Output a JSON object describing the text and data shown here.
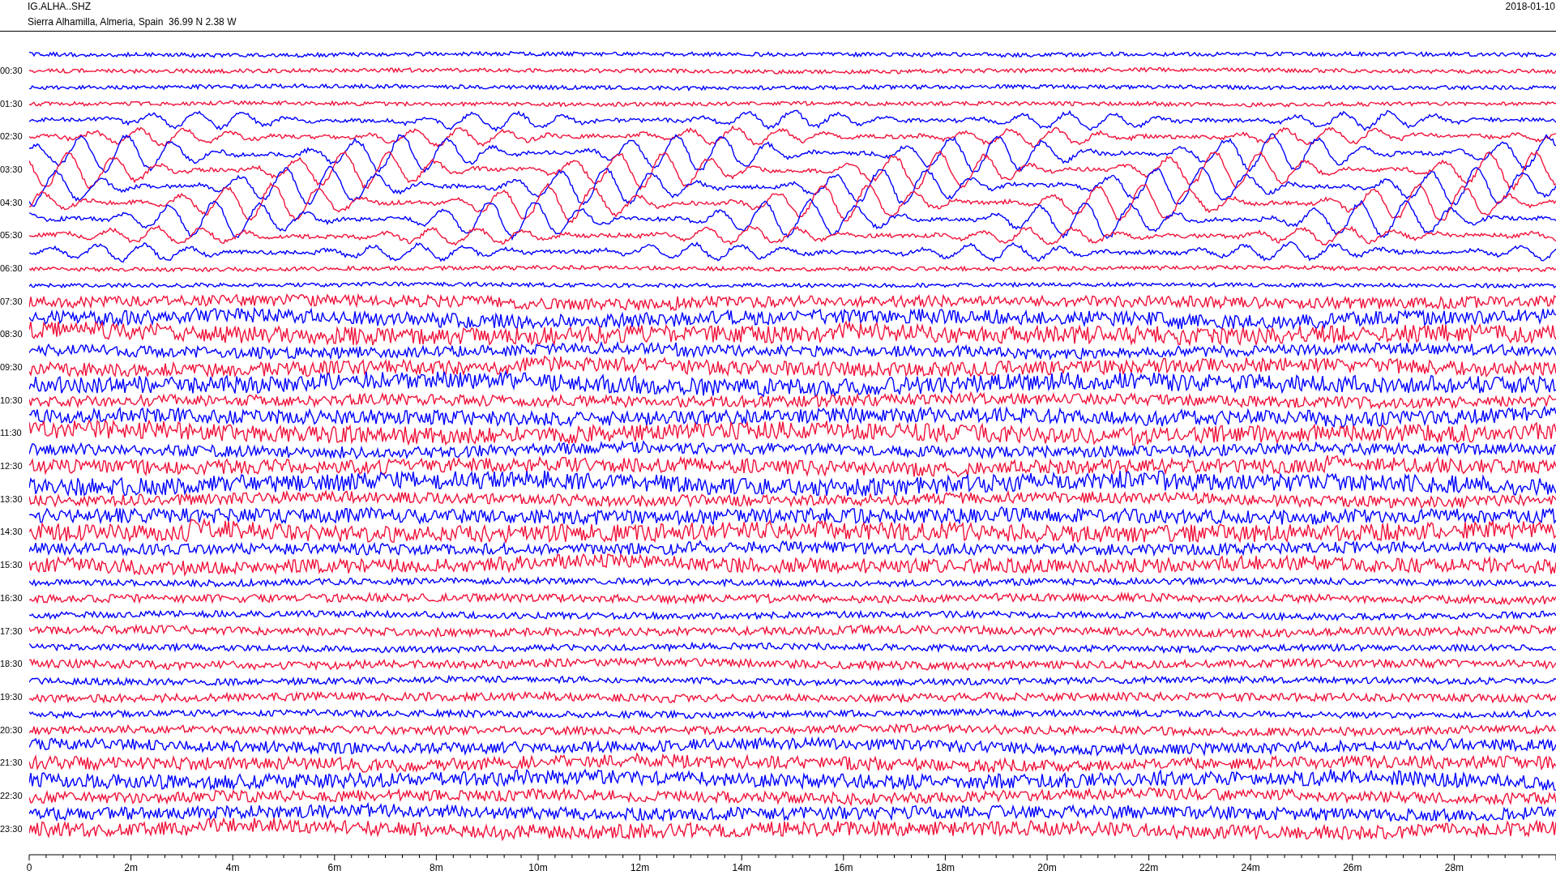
{
  "header": {
    "station": "IG.ALHA..SHZ",
    "location": "Sierra Alhamilla, Almeria, Spain  36.99 N 2.38 W",
    "date": "2018-01-10"
  },
  "hour_labels": [
    "00:30",
    "01:30",
    "02:30",
    "03:30",
    "04:30",
    "05:30",
    "06:30",
    "07:30",
    "08:30",
    "09:30",
    "10:30",
    "11:30",
    "12:30",
    "13:30",
    "14:30",
    "15:30",
    "16:30",
    "17:30",
    "18:30",
    "19:30",
    "20:30",
    "21:30",
    "22:30",
    "23:30"
  ],
  "traces": [
    {
      "color": "#0000ff"
    },
    {
      "color": "#f0143c"
    },
    {
      "color": "#0000ff"
    },
    {
      "color": "#f0143c"
    },
    {
      "color": "#0000ff"
    },
    {
      "color": "#f0143c"
    },
    {
      "color": "#0000ff"
    },
    {
      "color": "#f0143c"
    },
    {
      "color": "#0000ff"
    },
    {
      "color": "#f0143c"
    },
    {
      "color": "#0000ff"
    },
    {
      "color": "#f0143c"
    },
    {
      "color": "#0000ff"
    },
    {
      "color": "#f0143c"
    },
    {
      "color": "#0000ff"
    },
    {
      "color": "#f0143c"
    },
    {
      "color": "#0000ff"
    },
    {
      "color": "#f0143c"
    },
    {
      "color": "#0000ff"
    },
    {
      "color": "#f0143c"
    },
    {
      "color": "#0000ff"
    },
    {
      "color": "#f0143c"
    },
    {
      "color": "#0000ff"
    },
    {
      "color": "#f0143c"
    },
    {
      "color": "#0000ff"
    },
    {
      "color": "#f0143c"
    },
    {
      "color": "#0000ff"
    },
    {
      "color": "#f0143c"
    },
    {
      "color": "#0000ff"
    },
    {
      "color": "#f0143c"
    },
    {
      "color": "#0000ff"
    },
    {
      "color": "#f0143c"
    },
    {
      "color": "#0000ff"
    },
    {
      "color": "#f0143c"
    },
    {
      "color": "#0000ff"
    },
    {
      "color": "#f0143c"
    },
    {
      "color": "#0000ff"
    },
    {
      "color": "#f0143c"
    },
    {
      "color": "#0000ff"
    },
    {
      "color": "#f0143c"
    },
    {
      "color": "#0000ff"
    },
    {
      "color": "#f0143c"
    },
    {
      "color": "#0000ff"
    },
    {
      "color": "#f0143c"
    },
    {
      "color": "#0000ff"
    },
    {
      "color": "#f0143c"
    },
    {
      "color": "#0000ff"
    },
    {
      "color": "#f0143c"
    }
  ],
  "x_axis": {
    "labels": [
      "0",
      "2m",
      "4m",
      "6m",
      "8m",
      "10m",
      "12m",
      "14m",
      "16m",
      "18m",
      "20m",
      "22m",
      "24m",
      "26m",
      "28m"
    ]
  }
}
